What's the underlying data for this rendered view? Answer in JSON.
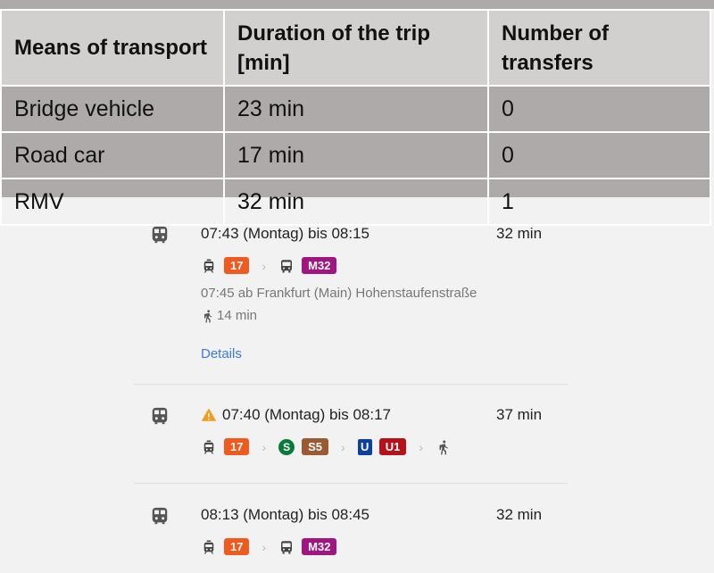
{
  "table": {
    "headers": [
      "Means of transport",
      "Duration of the trip [min]",
      "Number of transfers"
    ],
    "rows": [
      [
        "Bridge vehicle",
        "23 min",
        "0"
      ],
      [
        "Road car",
        "17 min",
        "0"
      ],
      [
        "RMV",
        "32 min",
        "1"
      ]
    ]
  },
  "trips": [
    {
      "time": "07:43 (Montag) bis 08:15",
      "duration": "32 min",
      "warning": false,
      "legs": [
        {
          "icon": "tram-icon",
          "label": "17",
          "color": "#f05a1e"
        },
        {
          "icon": "bus-icon",
          "label": "M32",
          "color": "#a0157f"
        }
      ],
      "departure": "07:45 ab Frankfurt (Main) Hohenstaufenstraße",
      "walk": "14 min",
      "details": "Details"
    },
    {
      "time": "07:40 (Montag) bis 08:17",
      "duration": "37 min",
      "warning": true,
      "legs": [
        {
          "icon": "tram-icon",
          "label": "17",
          "color": "#f05a1e"
        },
        {
          "icon": "s-bahn-icon",
          "label": "S5",
          "color": "#9a5b33"
        },
        {
          "icon": "u-bahn-icon",
          "label": "U1",
          "color": "#b5121b"
        },
        {
          "icon": "walk-icon"
        }
      ]
    },
    {
      "time": "08:13 (Montag) bis 08:45",
      "duration": "32 min",
      "warning": false,
      "legs": [
        {
          "icon": "tram-icon",
          "label": "17",
          "color": "#f05a1e"
        },
        {
          "icon": "bus-icon",
          "label": "M32",
          "color": "#a0157f"
        }
      ]
    }
  ],
  "icons": {
    "train": "train-icon",
    "warning": "warning-icon",
    "sbahn": "S",
    "ubahn": "U"
  }
}
